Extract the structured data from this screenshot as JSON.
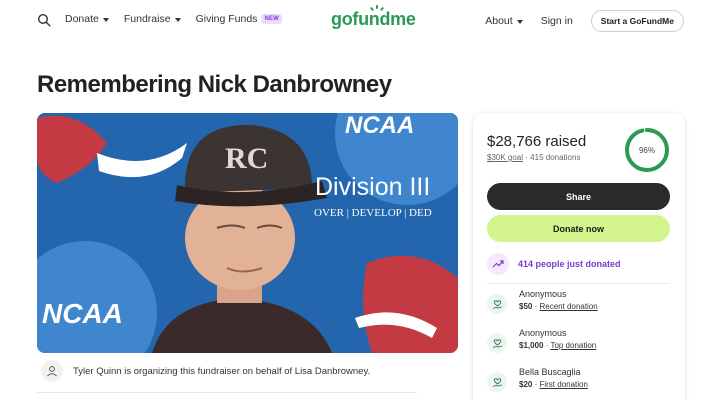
{
  "nav": {
    "donate": "Donate",
    "fundraise": "Fundraise",
    "giving_funds": "Giving Funds",
    "new_badge": "NEW",
    "logo": "gofundme",
    "about": "About",
    "sign_in": "Sign in",
    "start": "Start a GoFundMe"
  },
  "page": {
    "title": "Remembering Nick Danbrowney"
  },
  "hero": {
    "cap_letters": "RC",
    "banner_text": "Division III",
    "banner_sub": "OVER | DEVELOP | DED",
    "ncaa_top": "NCAA",
    "ncaa_bottom": "NCAA"
  },
  "organizer": {
    "text": "Tyler Quinn is organizing this fundraiser on behalf of Lisa Danbrowney."
  },
  "donation": {
    "raised": "$28,766 raised",
    "goal": "$30K goal",
    "separator": "·",
    "count": "415 donations",
    "percent_label": "96%",
    "percent": 0.96,
    "share_label": "Share",
    "donate_label": "Donate now",
    "activity": "414 people just donated",
    "donors": [
      {
        "name": "Anonymous",
        "amount": "$50",
        "tag": "Recent donation"
      },
      {
        "name": "Anonymous",
        "amount": "$1,000",
        "tag": "Top donation"
      },
      {
        "name": "Bella Buscaglia",
        "amount": "$20",
        "tag": "First donation"
      }
    ]
  },
  "colors": {
    "brand": "#2c9a55",
    "donate_button": "#d4f58e",
    "share_button": "#2a2a2a",
    "activity_accent": "#7a3bd1"
  }
}
